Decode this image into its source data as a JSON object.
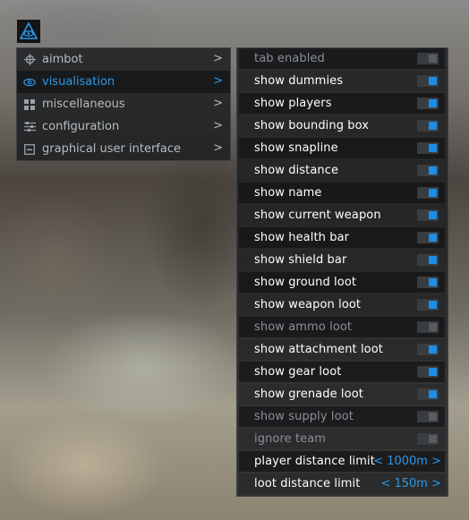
{
  "colors": {
    "accent": "#1d8ee6",
    "accent_text": "#2e98e8",
    "toggle_off_knob": "#595d61"
  },
  "menu": {
    "items": [
      {
        "label": "aimbot",
        "icon": "crosshair-icon",
        "chevron": ">",
        "active": false
      },
      {
        "label": "visualisation",
        "icon": "eye-icon",
        "chevron": ">",
        "active": true
      },
      {
        "label": "miscellaneous",
        "icon": "grid-icon",
        "chevron": ">",
        "active": false
      },
      {
        "label": "configuration",
        "icon": "sliders-icon",
        "chevron": ">",
        "active": false
      },
      {
        "label": "graphical user interface",
        "icon": "window-icon",
        "chevron": ">",
        "active": false
      }
    ]
  },
  "settings": {
    "toggles": [
      {
        "label": "tab enabled",
        "on": false
      },
      {
        "label": "show dummies",
        "on": true
      },
      {
        "label": "show players",
        "on": true
      },
      {
        "label": "show bounding box",
        "on": true
      },
      {
        "label": "show snapline",
        "on": true
      },
      {
        "label": "show distance",
        "on": true
      },
      {
        "label": "show name",
        "on": true
      },
      {
        "label": "show current weapon",
        "on": true
      },
      {
        "label": "show health bar",
        "on": true
      },
      {
        "label": "show shield bar",
        "on": true
      },
      {
        "label": "show ground loot",
        "on": true
      },
      {
        "label": "show weapon loot",
        "on": true
      },
      {
        "label": "show ammo loot",
        "on": false
      },
      {
        "label": "show attachment loot",
        "on": true
      },
      {
        "label": "show gear loot",
        "on": true
      },
      {
        "label": "show grenade loot",
        "on": true
      },
      {
        "label": "show supply loot",
        "on": false
      },
      {
        "label": "ignore team",
        "on": false
      }
    ],
    "player_distance": {
      "label": "player distance limit",
      "value": "< 1000m >"
    },
    "loot_distance": {
      "label": "loot distance limit",
      "value": "< 150m >"
    }
  }
}
